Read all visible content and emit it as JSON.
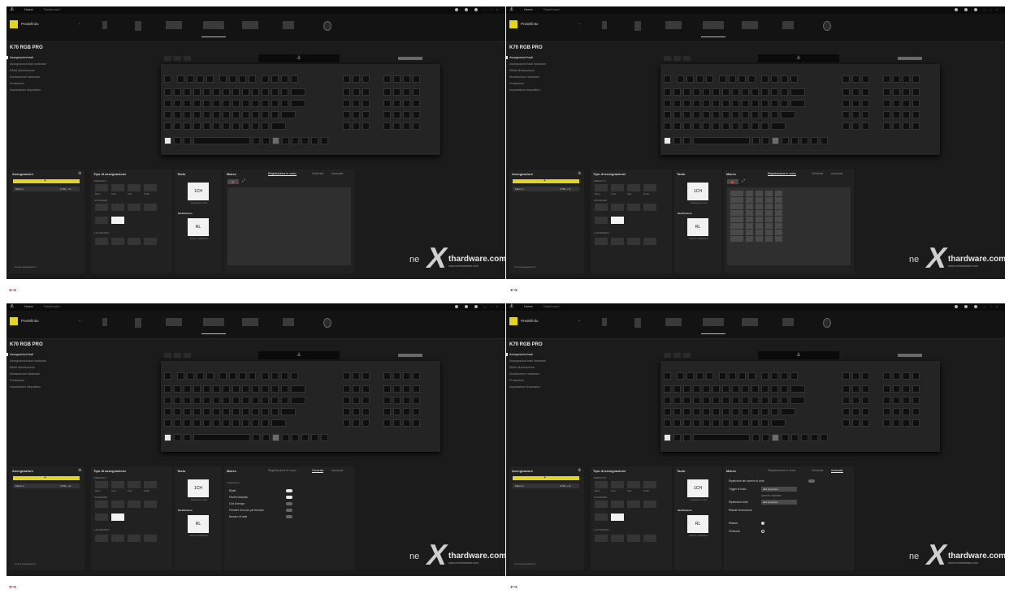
{
  "titlebar": {
    "home": "Home",
    "dashboard": "Dashboard",
    "window_controls": "— ▫ ×"
  },
  "profile": {
    "name": "Predefinito"
  },
  "keyboard": {
    "title": "K70 RGB PRO",
    "center_logo": "⚓"
  },
  "nav": {
    "items": [
      "Assegnazioni tasti",
      "Assegnazioni tasti hardware",
      "Effetti illuminazione",
      "Illuminazione hardware",
      "Prestazioni",
      "Impostazioni dispositivo"
    ]
  },
  "assign": {
    "title": "Assegnazioni",
    "bar_label": "+",
    "row_label": "Macro 1",
    "row_key": "CTRL + D",
    "footer": "Cerca assegnazioni"
  },
  "types": {
    "title": "Tipo di assegnazione",
    "sections": [
      "PREMUTO",
      "STANDARD",
      "LAVORANDO"
    ],
    "tile_labels": [
      "Macro",
      "Testo",
      "Tasti",
      "Profilo"
    ]
  },
  "testo": {
    "title": "Tasto",
    "box_text": "1CH",
    "caption": "Seleziona un tasto",
    "modifica_title": "Modificatore",
    "modifica_box": "RL",
    "modifica_caption": "Nessun modificatore"
  },
  "macro": {
    "title": "Macro",
    "tabs": [
      "Registrazione in corso",
      "Generale",
      "Avanzate"
    ],
    "generale_head": "Ripetizione",
    "generale_rows": [
      "Ripeti",
      "Finché rilasciato",
      "Cicli di tempo",
      "Premere di nuovo per fermare",
      "Numero di volte"
    ],
    "avanzate_rows": [
      "Ripetizione del numero di volte",
      "Trigger di inizio",
      "Quando rilasciato",
      "Ripetizione inizio",
      "Ritarda l'esecuzione"
    ],
    "avanzate_dd": [
      "Alla pressione",
      "Alla pressione"
    ],
    "avanzate_radios": [
      "Rilascio",
      "Pressione"
    ]
  },
  "watermark": {
    "ne": "ne",
    "x": "X",
    "hw": "thardware.com",
    "sub": "www.nexthardware.com"
  },
  "arrow": "↔"
}
